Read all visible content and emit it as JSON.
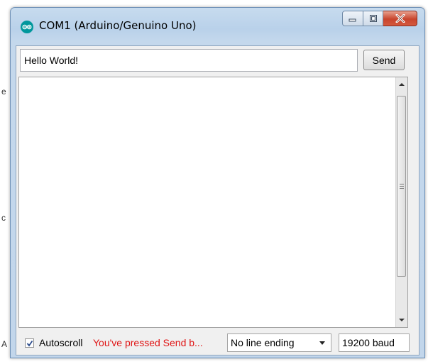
{
  "window": {
    "title": "COM1 (Arduino/Genuino Uno)"
  },
  "background": {
    "chars": [
      "e",
      "c",
      "A"
    ]
  },
  "input": {
    "value": "Hello World!"
  },
  "toolbar": {
    "send_label": "Send"
  },
  "footer": {
    "autoscroll_label": "Autoscroll",
    "autoscroll_checked": true,
    "status_message": "You've pressed Send b...",
    "line_ending": "No line ending",
    "baud_rate": "19200 baud"
  },
  "colors": {
    "status_message": "#e01515",
    "arduino_teal": "#00979c"
  }
}
